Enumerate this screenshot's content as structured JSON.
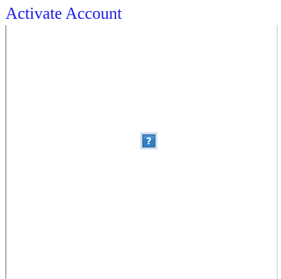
{
  "header": {
    "link_text": "Activate Account",
    "link_color": "#1a1ae6"
  },
  "content": {
    "placeholder_icon": "broken-image-question-icon",
    "placeholder_glyph": "?",
    "placeholder_color": "#2f7fc6"
  }
}
